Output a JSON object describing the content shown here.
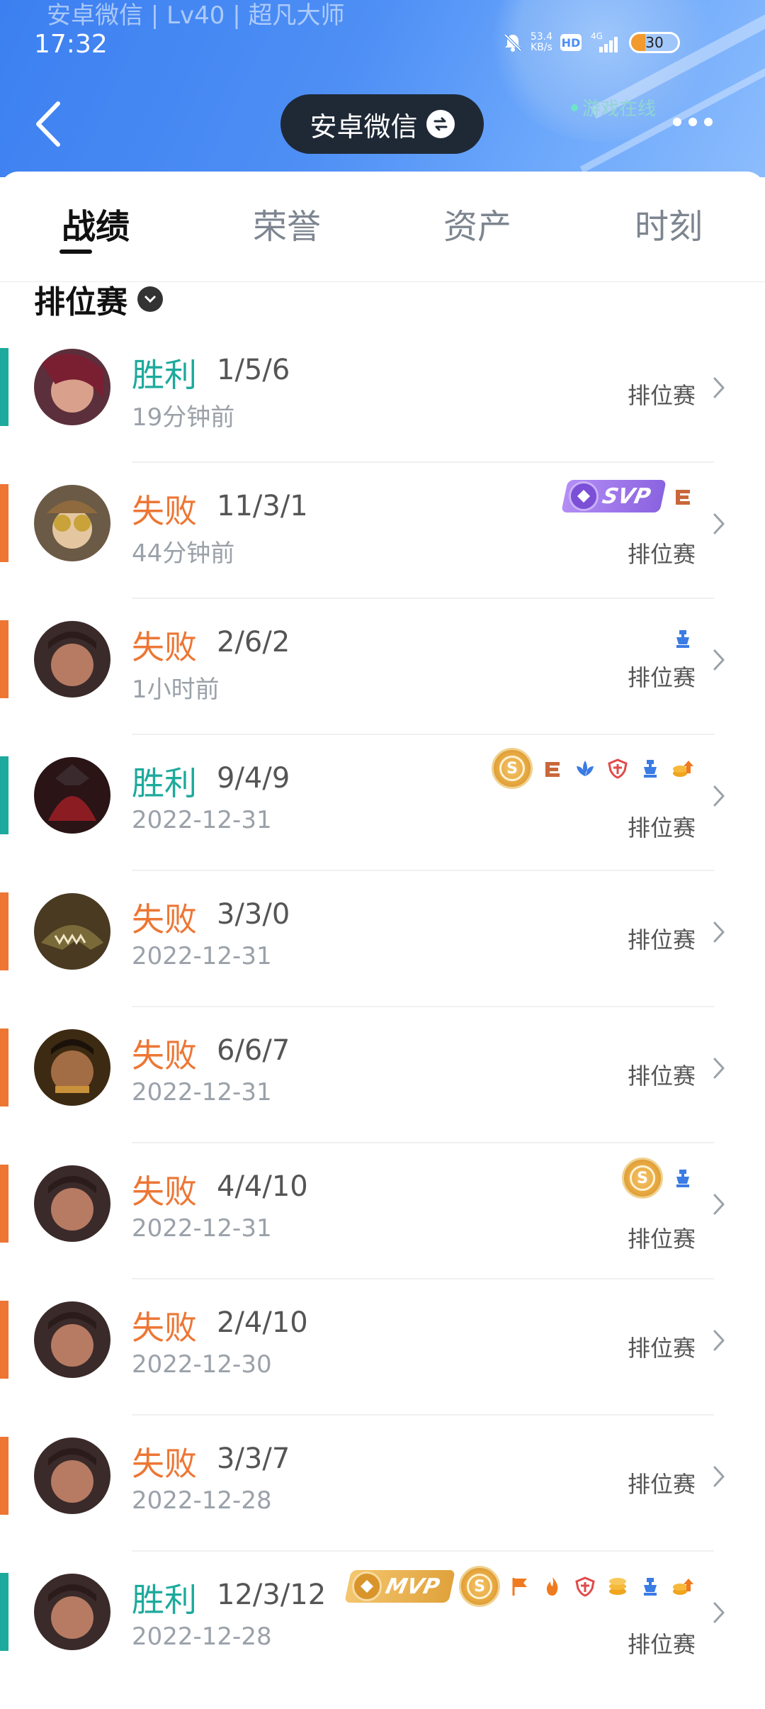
{
  "status_bar": {
    "time": "17:32",
    "net_speed_value": "53.4",
    "net_speed_unit": "KB/s",
    "hd": "HD",
    "network": "4G",
    "battery": "30"
  },
  "header": {
    "faded_title": "安卓微信 | Lv40 | 超凡大师",
    "title": "安卓微信",
    "online_status": "游戏在线"
  },
  "tabs": [
    {
      "label": "战绩",
      "active": true
    },
    {
      "label": "荣誉",
      "active": false
    },
    {
      "label": "资产",
      "active": false
    },
    {
      "label": "时刻",
      "active": false
    }
  ],
  "filter": {
    "label": "排位赛"
  },
  "matches": [
    {
      "result": "胜利",
      "kda": "1/5/6",
      "time": "19分钟前",
      "mode": "排位赛",
      "outcome": "win",
      "badges": []
    },
    {
      "result": "失败",
      "kda": "11/3/1",
      "time": "44分钟前",
      "mode": "排位赛",
      "outcome": "loss",
      "badges": [
        "svp-tag",
        "triple-kill-icon"
      ],
      "award": "SVP"
    },
    {
      "result": "失败",
      "kda": "2/6/2",
      "time": "1小时前",
      "mode": "排位赛",
      "outcome": "loss",
      "badges": [
        "tower-icon"
      ]
    },
    {
      "result": "胜利",
      "kda": "9/4/9",
      "time": "2022-12-31",
      "mode": "排位赛",
      "outcome": "win",
      "badges": [
        "gold-coin-icon",
        "triple-kill-icon",
        "flower-icon",
        "shield-icon",
        "tower-icon",
        "gold-up-icon"
      ]
    },
    {
      "result": "失败",
      "kda": "3/3/0",
      "time": "2022-12-31",
      "mode": "排位赛",
      "outcome": "loss",
      "badges": []
    },
    {
      "result": "失败",
      "kda": "6/6/7",
      "time": "2022-12-31",
      "mode": "排位赛",
      "outcome": "loss",
      "badges": []
    },
    {
      "result": "失败",
      "kda": "4/4/10",
      "time": "2022-12-31",
      "mode": "排位赛",
      "outcome": "loss",
      "badges": [
        "gold-coin-icon",
        "tower-icon"
      ]
    },
    {
      "result": "失败",
      "kda": "2/4/10",
      "time": "2022-12-30",
      "mode": "排位赛",
      "outcome": "loss",
      "badges": []
    },
    {
      "result": "失败",
      "kda": "3/3/7",
      "time": "2022-12-28",
      "mode": "排位赛",
      "outcome": "loss",
      "badges": []
    },
    {
      "result": "胜利",
      "kda": "12/3/12",
      "time": "2022-12-28",
      "mode": "排位赛",
      "outcome": "win",
      "badges": [
        "mvp-tag",
        "gold-coin-icon",
        "flag-icon",
        "fire-icon",
        "shield-icon",
        "gold-stack-icon",
        "tower-icon",
        "gold-up-icon"
      ],
      "award": "MVP"
    }
  ],
  "colors": {
    "win": "#1daa9c",
    "loss": "#ed7634",
    "header_blue": "#4e8ff5"
  }
}
